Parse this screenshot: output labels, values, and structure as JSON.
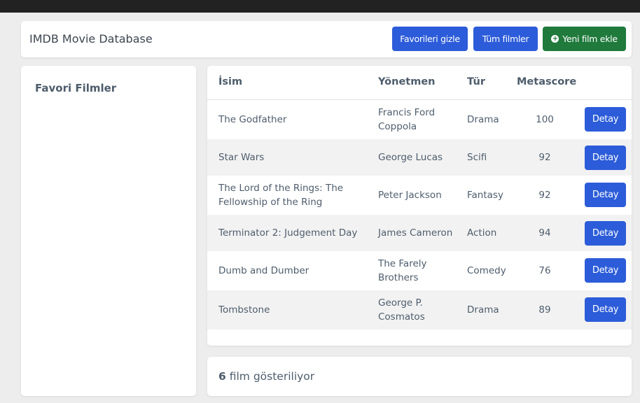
{
  "header": {
    "title": "IMDB Movie Database",
    "hide_favorites_label": "Favorileri gizle",
    "all_movies_label": "Tüm filmler",
    "add_movie_label": "Yeni film ekle",
    "add_icon": "plus-circle-icon"
  },
  "sidebar": {
    "title": "Favori Filmler"
  },
  "table": {
    "columns": [
      "İsim",
      "Yönetmen",
      "Tür",
      "Metascore"
    ],
    "detail_label": "Detay",
    "rows": [
      {
        "name": "The Godfather",
        "director": "Francis Ford Coppola",
        "genre": "Drama",
        "metascore": "100"
      },
      {
        "name": "Star Wars",
        "director": "George Lucas",
        "genre": "Scifi",
        "metascore": "92"
      },
      {
        "name": "The Lord of the Rings: The Fellowship of the Ring",
        "director": "Peter Jackson",
        "genre": "Fantasy",
        "metascore": "92"
      },
      {
        "name": "Terminator 2: Judgement Day",
        "director": "James Cameron",
        "genre": "Action",
        "metascore": "94"
      },
      {
        "name": "Dumb and Dumber",
        "director": "The Farely Brothers",
        "genre": "Comedy",
        "metascore": "76"
      },
      {
        "name": "Tombstone",
        "director": "George P. Cosmatos",
        "genre": "Drama",
        "metascore": "89"
      }
    ]
  },
  "footer": {
    "count": "6",
    "suffix": " film gösteriliyor"
  },
  "colors": {
    "primary": "#2c5cd9",
    "success": "#1f7a3c",
    "topbar": "#222222"
  }
}
